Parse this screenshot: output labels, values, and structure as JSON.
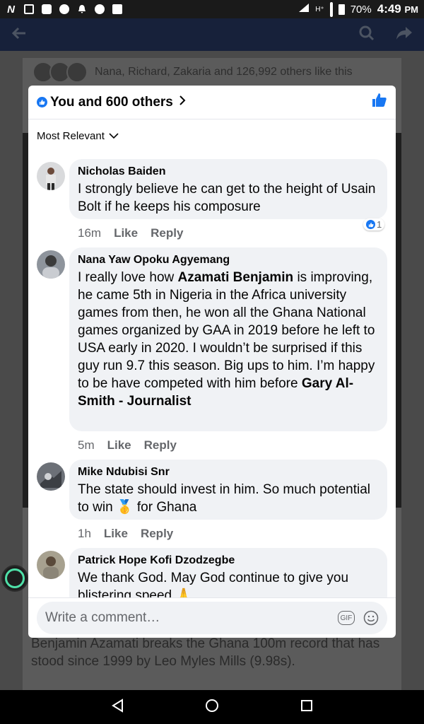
{
  "status_bar": {
    "battery": "70%",
    "time": "4:49",
    "ampm": "PM"
  },
  "background": {
    "likes_text": "Nana, Richard, Zakaria and 126,992 others like this",
    "caption": "Benjamin Azamati breaks the Ghana 100m record that has stood since 1999 by Leo Myles Mills (9.98s)."
  },
  "sheet": {
    "title": "You and 600 others",
    "sort_label": "Most Relevant"
  },
  "comments": [
    {
      "author": "Nicholas Baiden",
      "text": "I strongly believe he can get to the height of Usain Bolt if he keeps his composure",
      "time": "16m",
      "like": "Like",
      "reply": "Reply",
      "reaction_count": "1"
    },
    {
      "author": "Nana Yaw Opoku Agyemang",
      "text_1": "I really love how ",
      "mention_1": "Azamati Benjamin",
      "text_2": " is improving, he came 5th in Nigeria in the Africa university games from then, he won all the Ghana National games organized by GAA in 2019 before he left to USA early in 2020. I wouldn’t be surprised if this guy run 9.7 this season. Big ups to him. I’m happy to be have competed with him before ",
      "mention_2": "Gary Al-Smith - Journalist",
      "time": "5m",
      "like": "Like",
      "reply": "Reply"
    },
    {
      "author": "Mike Ndubisi Snr",
      "text_1": "The state should invest in him. So much potential to win ",
      "emoji": "🥇",
      "text_2": " for Ghana",
      "time": "1h",
      "like": "Like",
      "reply": "Reply"
    },
    {
      "author": "Patrick Hope Kofi Dzodzegbe",
      "text": "We thank God. May God continue to give you blistering speed 🙏"
    }
  ],
  "composer": {
    "placeholder": "Write a comment…",
    "gif_label": "GIF"
  },
  "colors": {
    "accent": "#1877f2",
    "bubble": "#f0f2f5",
    "meta": "#65676b",
    "assistive": "#4fe0a8"
  }
}
